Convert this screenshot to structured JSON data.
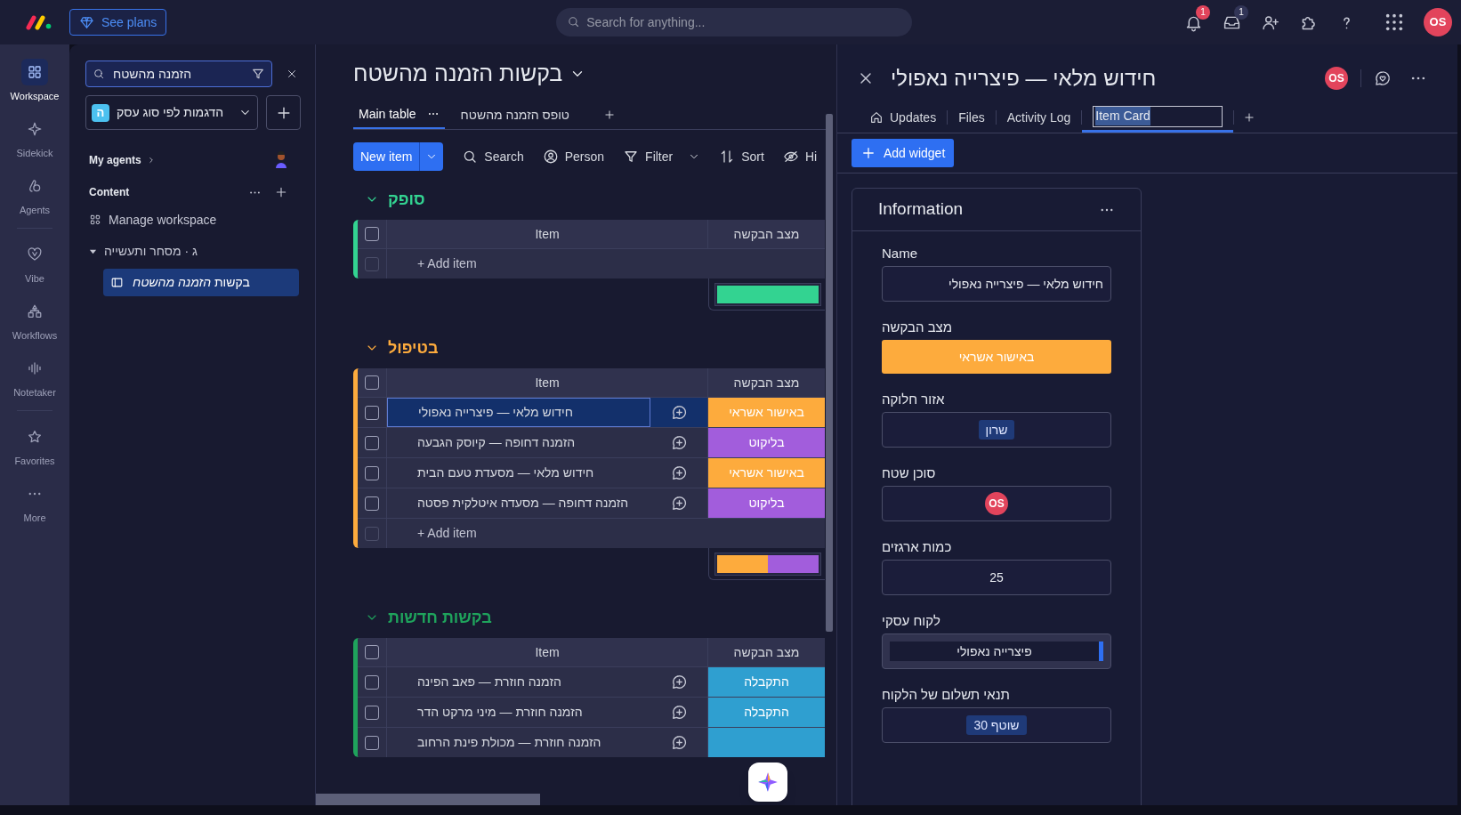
{
  "top_bar": {
    "see_plans": "See plans",
    "search": {
      "placeholder": "Search for anything..."
    },
    "notification_badge": "1",
    "inbox_badge": "1",
    "avatar": "OS"
  },
  "rail": {
    "sections": [
      {
        "items": [
          {
            "kind": "workspace",
            "label": "Workspace",
            "selected": true
          },
          {
            "kind": "sidekick",
            "label": "Sidekick",
            "selected": false
          },
          {
            "kind": "agents",
            "label": "Agents",
            "selected": false
          }
        ]
      },
      {
        "items": [
          {
            "kind": "vibe",
            "label": "Vibe",
            "selected": false
          },
          {
            "kind": "workflows",
            "label": "Workflows",
            "selected": false
          },
          {
            "kind": "notetaker",
            "label": "Notetaker",
            "selected": false
          }
        ]
      },
      {
        "items": [
          {
            "kind": "favorites",
            "label": "Favorites",
            "selected": false
          },
          {
            "kind": "more",
            "label": "More",
            "selected": false
          }
        ]
      }
    ]
  },
  "sidebar": {
    "search": {
      "value": "הזמנה מהשטח"
    },
    "workspace": {
      "badge": "ה",
      "name": "הדגמות לפי סוג עסק"
    },
    "my_agents": "My agents",
    "content": "Content",
    "manage_workspace": "Manage workspace",
    "tree": [
      {
        "label": "ג · מסחר ותעשייה",
        "expanded": true,
        "children": [
          {
            "label": "בקשות *הזמנה מהשטח*",
            "selected": true
          }
        ]
      }
    ]
  },
  "board": {
    "title": "בקשות הזמנה מהשטח",
    "tabs": [
      {
        "label": "טופס הזמנה מהשטח",
        "selected": false
      },
      {
        "label": "Main table",
        "selected": true
      }
    ],
    "new_item": "New item",
    "tools": [
      {
        "kind": "hide",
        "label": "Hi"
      },
      {
        "kind": "sort",
        "label": "Sort"
      },
      {
        "kind": "filter",
        "label": "Filter"
      },
      {
        "kind": "person",
        "label": "Person"
      },
      {
        "kind": "search",
        "label": "Search"
      }
    ],
    "groups": [
      {
        "title": "סופק",
        "color": "#33d391",
        "expanded": true,
        "all_checked": false,
        "columns": [
          "מצב הבקשה",
          "Item"
        ],
        "add_item": "+ Add item",
        "summary": [
          {
            "color": "#33d391",
            "level": 1
          }
        ]
      },
      {
        "title": "בטיפול",
        "color": "#fdab3d",
        "expanded": true,
        "all_checked": false,
        "columns": [
          "מצב הבקשה",
          "Item"
        ],
        "rows": [
          {
            "name": "חידוש מלאי — פיצרייה נאפולי",
            "status": "באישור אשראי",
            "color": "#fdab3d",
            "selected": true,
            "checked": false
          },
          {
            "name": "הזמנה דחופה — קיוסק הגבעה",
            "status": "בליקוט",
            "color": "#a25ddc",
            "selected": false,
            "checked": false
          },
          {
            "name": "חידוש מלאי — מסעדת טעם הבית",
            "status": "באישור אשראי",
            "color": "#fdab3d",
            "selected": false,
            "checked": false
          },
          {
            "name": "הזמנה דחופה — מסעדה איטלקית פסטה",
            "status": "בליקוט",
            "color": "#a25ddc",
            "selected": false,
            "checked": false
          }
        ],
        "add_item": "+ Add item",
        "summary": [
          {
            "color": "#fdab3d",
            "level": 0.5
          },
          {
            "color": "#a25ddc",
            "level": 0.5
          }
        ]
      },
      {
        "title": "בקשות חדשות",
        "color": "#1fa35c",
        "expanded": true,
        "all_checked": false,
        "columns": [
          "מצב הבקשה",
          "Item"
        ],
        "rows": [
          {
            "name": "הזמנה חוזרת — פאב הפינה",
            "status": "התקבלה",
            "color": "#2f9fd0",
            "selected": false,
            "checked": false
          },
          {
            "name": "הזמנה חוזרת — מיני מרקט הדר",
            "status": "התקבלה",
            "color": "#2f9fd0",
            "selected": false,
            "checked": false
          },
          {
            "name": "הזמנה חוזרת — מכולת פינת הרחוב",
            "color": "#2f9fd0",
            "selected": false,
            "checked": false
          }
        ]
      }
    ]
  },
  "item_panel": {
    "title": "חידוש מלאי — פיצרייה נאפולי",
    "avatar": "OS",
    "tabs": [
      {
        "label": "Item Card",
        "selected": true
      },
      {
        "label": "Activity Log",
        "selected": false
      },
      {
        "label": "Files",
        "selected": false
      },
      {
        "kind": "home",
        "label": "Updates",
        "selected": false
      }
    ],
    "add_widget": "Add widget",
    "card": {
      "title": "Information",
      "fields": [
        {
          "kind": "text",
          "label": "Name",
          "value": "חידוש מלאי — פיצרייה נאפולי"
        },
        {
          "kind": "status",
          "label": "מצב הבקשה",
          "value": "באישור אשראי",
          "color": "#fdab3d"
        },
        {
          "kind": "tag",
          "label": "אזור חלוקה",
          "value": "שרון"
        },
        {
          "kind": "person",
          "label": "סוכן שטח",
          "value": "OS"
        },
        {
          "kind": "number",
          "label": "כמות ארגזים",
          "value": "25"
        },
        {
          "kind": "link",
          "label": "לקוח עסקי",
          "value": "פיצרייה נאפולי"
        },
        {
          "kind": "tag",
          "label": "תנאי תשלום של הלקוח",
          "value": "שוטף 30"
        }
      ]
    }
  }
}
